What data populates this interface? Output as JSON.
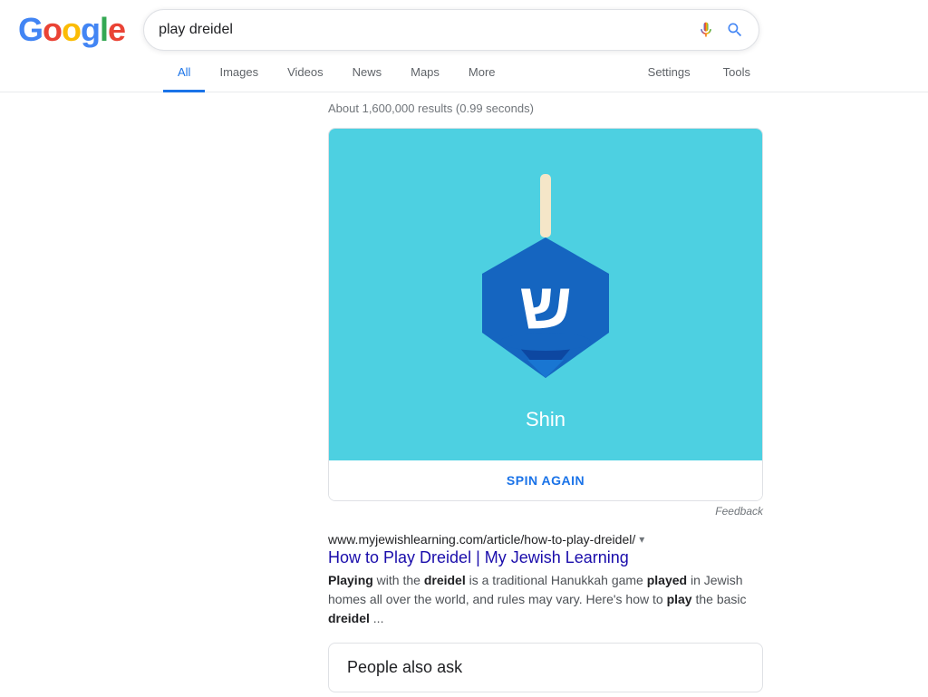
{
  "header": {
    "logo": "Google",
    "logo_letters": [
      {
        "char": "G",
        "color": "#4285F4"
      },
      {
        "char": "o",
        "color": "#EA4335"
      },
      {
        "char": "o",
        "color": "#FBBC05"
      },
      {
        "char": "g",
        "color": "#4285F4"
      },
      {
        "char": "l",
        "color": "#34A853"
      },
      {
        "char": "e",
        "color": "#EA4335"
      }
    ],
    "search_query": "play dreidel",
    "search_placeholder": "Search"
  },
  "nav": {
    "tabs": [
      {
        "label": "All",
        "active": true
      },
      {
        "label": "Images",
        "active": false
      },
      {
        "label": "Videos",
        "active": false
      },
      {
        "label": "News",
        "active": false
      },
      {
        "label": "Maps",
        "active": false
      },
      {
        "label": "More",
        "active": false
      }
    ],
    "right_tabs": [
      {
        "label": "Settings"
      },
      {
        "label": "Tools"
      }
    ]
  },
  "results_count": "About 1,600,000 results (0.99 seconds)",
  "dreidel_widget": {
    "current_face": "Shin",
    "spin_again_label": "SPIN AGAIN",
    "feedback_label": "Feedback"
  },
  "search_result": {
    "title": "How to Play Dreidel | My Jewish Learning",
    "url": "www.myjewishlearning.com/article/how-to-play-dreidel/",
    "snippet_parts": [
      {
        "text": "Playing",
        "bold": true
      },
      {
        "text": " with the ",
        "bold": false
      },
      {
        "text": "dreidel",
        "bold": true
      },
      {
        "text": " is a traditional Hanukkah game ",
        "bold": false
      },
      {
        "text": "played",
        "bold": true
      },
      {
        "text": " in Jewish homes all over the world, and rules may vary. Here's how to ",
        "bold": false
      },
      {
        "text": "play",
        "bold": true
      },
      {
        "text": " the basic ",
        "bold": false
      },
      {
        "text": "dreidel",
        "bold": true
      },
      {
        "text": " ...",
        "bold": false
      }
    ]
  },
  "people_also_ask": {
    "title": "People also ask"
  }
}
